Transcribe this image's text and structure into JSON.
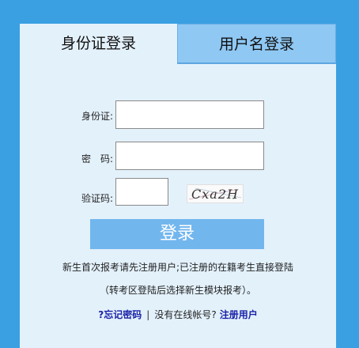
{
  "tabs": {
    "id_login": "身份证登录",
    "user_login": "用户名登录"
  },
  "form": {
    "id_label": "身份证:",
    "password_label": "密　码:",
    "captcha_label": "验证码:",
    "id_value": "",
    "password_value": "",
    "captcha_value": "",
    "captcha_image_text": "Cxa2H"
  },
  "login_button": "登录",
  "notes": {
    "line1": "新生首次报考请先注册用户;已注册的在籍考生直接登陆",
    "line2": "（转考区登陆后选择新生模块报考）。"
  },
  "links": {
    "forgot": "?忘记密码",
    "separator": "|",
    "no_account": "没有在线帐号?",
    "register": "注册用户"
  },
  "colors": {
    "background": "#3aa0e2",
    "panel": "#e3f1fb",
    "inactive_tab": "#8fc8f3",
    "login_button": "#72b6ee",
    "link": "#1a22a8"
  }
}
